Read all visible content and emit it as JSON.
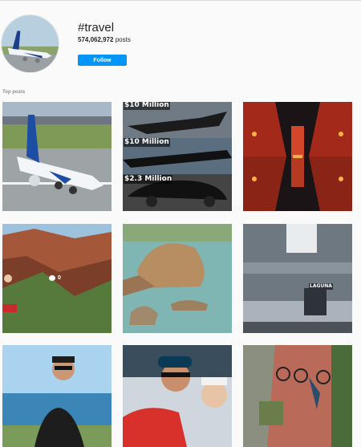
{
  "header": {
    "hashtag": "#travel",
    "post_count": "574,062,972",
    "post_count_suffix": "posts",
    "follow_label": "Follow"
  },
  "sections": {
    "top_posts_label": "Top posts"
  },
  "posts": [
    {
      "labels": [],
      "description_icon": "airplane-photo"
    },
    {
      "labels": [
        "$10 Million",
        "$10 Million",
        "$2.3 Million"
      ]
    },
    {
      "labels": []
    },
    {
      "labels": [],
      "comment_count": "0"
    },
    {
      "labels": []
    },
    {
      "labels": [],
      "sign_text": "LAGUNA"
    },
    {
      "labels": []
    },
    {
      "labels": []
    },
    {
      "labels": []
    }
  ],
  "colors": {
    "accent": "#0095f6",
    "background": "#fafafa",
    "muted_text": "#8e8e8e"
  }
}
